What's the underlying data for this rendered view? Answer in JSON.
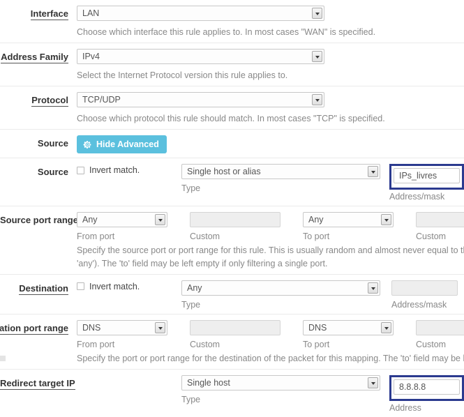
{
  "rows": {
    "interface": {
      "label": "Interface",
      "select_value": "LAN",
      "help": "Choose which interface this rule applies to. In most cases \"WAN\" is specified."
    },
    "address_family": {
      "label": "Address Family",
      "select_value": "IPv4",
      "help": "Select the Internet Protocol version this rule applies to."
    },
    "protocol": {
      "label": "Protocol",
      "select_value": "TCP/UDP",
      "help": "Choose which protocol this rule should match. In most cases \"TCP\" is specified."
    },
    "source_advanced": {
      "label": "Source",
      "button_label": "Hide Advanced",
      "button_icon": "gear-icon",
      "button_color": "#5bc0de"
    },
    "source": {
      "label": "Source",
      "invert_label": "Invert match.",
      "invert_checked": false,
      "type_value": "Single host or alias",
      "type_sublabel": "Type",
      "address_value": "IPs_livres",
      "address_sublabel": "Address/mask",
      "address_highlighted": true,
      "highlight_color": "#2b3a8f"
    },
    "source_port_range": {
      "label": "Source port range",
      "label_underlined": false,
      "from_value": "Any",
      "from_sublabel": "From port",
      "from_custom_value": "",
      "from_custom_sublabel": "Custom",
      "to_value": "Any",
      "to_sublabel": "To port",
      "to_custom_value": "",
      "to_custom_sublabel": "Custom",
      "help_line1": "Specify the source port or port range for this rule. This is usually random and almost never equal to the destina",
      "help_line2": "'any'). The 'to' field may be left empty if only filtering a single port."
    },
    "destination": {
      "label": "Destination",
      "invert_label": "Invert match.",
      "invert_checked": false,
      "type_value": "Any",
      "type_sublabel": "Type",
      "address_value": "",
      "address_sublabel": "Address/mask"
    },
    "destination_port_range": {
      "label": "Destination port range",
      "label_clipped": "stination port range",
      "from_value": "DNS",
      "from_sublabel": "From port",
      "from_custom_value": "",
      "from_custom_sublabel": "Custom",
      "to_value": "DNS",
      "to_sublabel": "To port",
      "to_custom_value": "",
      "to_custom_sublabel": "Custom",
      "help_line1": "Specify the port or port range for the destination of the packet for this mapping. The 'to' field may be left empty"
    },
    "redirect_target_ip": {
      "label": "Redirect target IP",
      "type_value": "Single host",
      "type_sublabel": "Type",
      "address_value": "8.8.8.8",
      "address_sublabel": "Address",
      "address_highlighted": true,
      "highlight_color": "#2b3a8f"
    }
  }
}
